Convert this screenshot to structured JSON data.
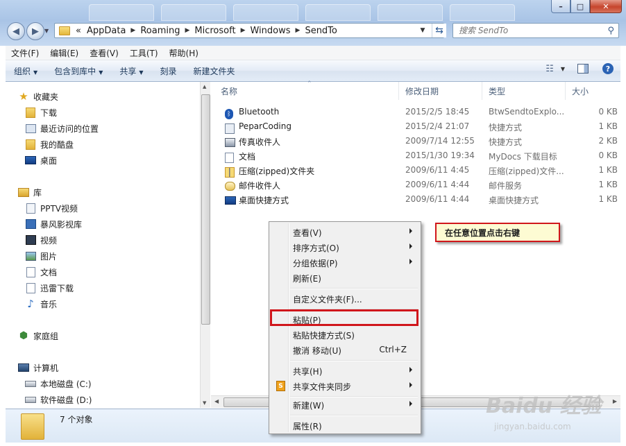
{
  "address": {
    "crumbs": [
      "AppData",
      "Roaming",
      "Microsoft",
      "Windows",
      "SendTo"
    ],
    "overflow": "«",
    "search_placeholder": "搜索 SendTo"
  },
  "menubar": [
    "文件(F)",
    "编辑(E)",
    "查看(V)",
    "工具(T)",
    "帮助(H)"
  ],
  "commands": {
    "organize": "组织",
    "include_library": "包含到库中",
    "share": "共享",
    "burn": "刻录",
    "new_folder": "新建文件夹"
  },
  "nav": {
    "favorites": "收藏夹",
    "fav_items": [
      "下载",
      "最近访问的位置",
      "我的酷盘",
      "桌面"
    ],
    "libraries": "库",
    "lib_items": [
      "PPTV视频",
      "暴风影视库",
      "视频",
      "图片",
      "文档",
      "迅雷下载",
      "音乐"
    ],
    "homegroup": "家庭组",
    "computer": "计算机",
    "drives": [
      "本地磁盘 (C:)",
      "软件磁盘 (D:)"
    ]
  },
  "columns": {
    "name": "名称",
    "date": "修改日期",
    "type": "类型",
    "size": "大小"
  },
  "files": [
    {
      "name": "Bluetooth",
      "date": "2015/2/5 18:45",
      "type": "BtwSendtoExplo...",
      "size": "0 KB",
      "icon": "bluetooth-icon"
    },
    {
      "name": "PeparCoding",
      "date": "2015/2/4 21:07",
      "type": "快捷方式",
      "size": "1 KB",
      "icon": "shortcut-icon"
    },
    {
      "name": "传真收件人",
      "date": "2009/7/14 12:55",
      "type": "快捷方式",
      "size": "2 KB",
      "icon": "fax-icon"
    },
    {
      "name": "文档",
      "date": "2015/1/30 19:34",
      "type": "MyDocs 下载目标",
      "size": "0 KB",
      "icon": "document-icon"
    },
    {
      "name": "压缩(zipped)文件夹",
      "date": "2009/6/11 4:45",
      "type": "压缩(zipped)文件...",
      "size": "1 KB",
      "icon": "zip-folder-icon"
    },
    {
      "name": "邮件收件人",
      "date": "2009/6/11 4:44",
      "type": "邮件服务",
      "size": "1 KB",
      "icon": "mail-icon"
    },
    {
      "name": "桌面快捷方式",
      "date": "2009/6/11 4:44",
      "type": "桌面快捷方式",
      "size": "1 KB",
      "icon": "desktop-icon"
    }
  ],
  "details": {
    "count": "7 个对象"
  },
  "context_menu": {
    "view": "查看(V)",
    "sort": "排序方式(O)",
    "group": "分组依据(P)",
    "refresh": "刷新(E)",
    "customize": "自定义文件夹(F)...",
    "paste": "粘贴(P)",
    "paste_shortcut": "粘贴快捷方式(S)",
    "undo": "撤消 移动(U)",
    "undo_shortcut": "Ctrl+Z",
    "share": "共享(H)",
    "sync": "共享文件夹同步",
    "new": "新建(W)",
    "properties": "属性(R)"
  },
  "callout": "在任意位置点击右键",
  "watermark": {
    "brand": "Baidu 经验",
    "url": "jingyan.baidu.com"
  },
  "colors": {
    "highlight": "#d0161b",
    "callout_bg": "#fdfbd3",
    "link_blue": "#1e395b"
  }
}
